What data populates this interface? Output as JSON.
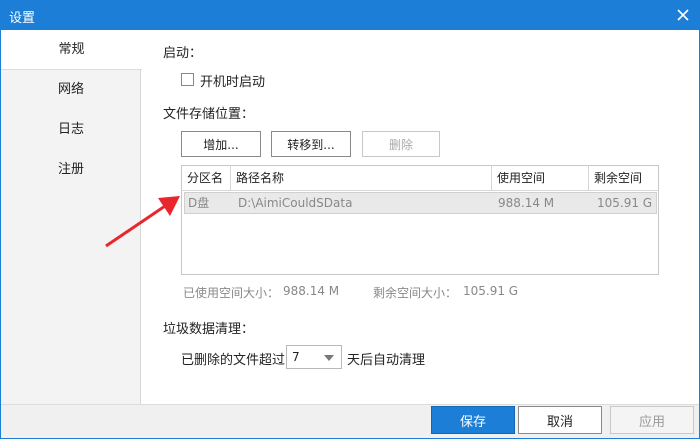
{
  "window": {
    "title": "设置"
  },
  "sidebar": {
    "items": [
      {
        "label": "常规",
        "active": true
      },
      {
        "label": "网络",
        "active": false
      },
      {
        "label": "日志",
        "active": false
      },
      {
        "label": "注册",
        "active": false
      }
    ]
  },
  "startup": {
    "section_label": "启动：",
    "checkbox_label": "开机时启动",
    "checked": false
  },
  "storage": {
    "section_label": "文件存储位置：",
    "buttons": {
      "add": "增加...",
      "move": "转移到...",
      "delete": "删除"
    },
    "table": {
      "headers": [
        "分区名",
        "路径名称",
        "使用空间",
        "剩余空间"
      ],
      "rows": [
        {
          "partition": "D盘",
          "path": "D:\\AimiCouldSData",
          "used": "988.14 M",
          "free": "105.91 G"
        }
      ]
    },
    "used_label": "已使用空间大小：",
    "used_value": "988.14 M",
    "free_label": "剩余空间大小：",
    "free_value": "105.91 G"
  },
  "cleanup": {
    "section_label": "垃圾数据清理：",
    "prefix": "已删除的文件超过",
    "days": "7",
    "suffix": "天后自动清理"
  },
  "footer": {
    "save": "保存",
    "cancel": "取消",
    "apply": "应用"
  },
  "colors": {
    "accent": "#1c7ed6",
    "annotation_arrow": "#e8262b"
  }
}
